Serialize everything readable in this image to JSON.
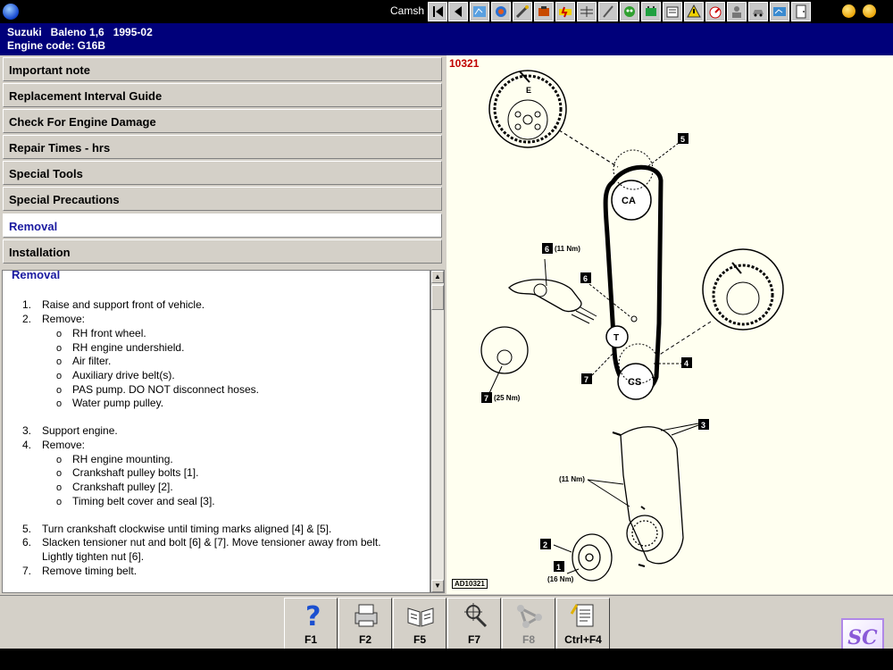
{
  "titlebar": {
    "title": "Camsh"
  },
  "header": {
    "vehicle": "Suzuki   Baleno 1,6   1995-02",
    "engine": "Engine code: G16B"
  },
  "menu": {
    "items": [
      {
        "label": "Important note"
      },
      {
        "label": "Replacement Interval Guide"
      },
      {
        "label": "Check For Engine Damage"
      },
      {
        "label": "Repair Times - hrs"
      },
      {
        "label": "Special Tools"
      },
      {
        "label": "Special Precautions"
      },
      {
        "label": "Removal"
      },
      {
        "label": "Installation"
      }
    ],
    "active": "Removal"
  },
  "content": {
    "heading": "Removal",
    "steps": [
      {
        "num": "1.",
        "text": "Raise and support front of vehicle."
      },
      {
        "num": "2.",
        "text": "Remove:"
      },
      {
        "num": "3.",
        "text": "Support engine."
      },
      {
        "num": "4.",
        "text": "Remove:"
      },
      {
        "num": "5.",
        "text": "Turn crankshaft clockwise until timing marks aligned [4] & [5]."
      },
      {
        "num": "6.",
        "text": "Slacken tensioner nut and bolt [6] & [7]. Move tensioner away from belt."
      },
      {
        "num": "",
        "text": "Lightly tighten nut [6]."
      },
      {
        "num": "7.",
        "text": "Remove timing belt."
      }
    ],
    "sub2": [
      "RH front wheel.",
      "RH engine undershield.",
      "Air filter.",
      "Auxiliary drive belt(s).",
      "PAS pump. DO NOT disconnect hoses.",
      "Water pump pulley."
    ],
    "sub4": [
      "RH engine mounting.",
      "Crankshaft pulley bolts [1].",
      "Crankshaft pulley [2].",
      "Timing belt cover and seal [3]."
    ],
    "bullet": "o"
  },
  "diagram": {
    "figure_id": "10321",
    "figure_ref": "AD10321",
    "labels": {
      "ca": "CA",
      "cs": "CS",
      "t": "T",
      "e": "E",
      "n1": "1",
      "n2": "2",
      "n3": "3",
      "n4": "4",
      "n5": "5",
      "n6": "6",
      "n7": "7",
      "torque6": "(11 Nm)",
      "torque7": "(25 Nm)",
      "torque_cover": "(11 Nm)",
      "torque1": "(16 Nm)"
    }
  },
  "function_keys": [
    {
      "label": "F1",
      "icon": "help-icon"
    },
    {
      "label": "F2",
      "icon": "printer-icon"
    },
    {
      "label": "F5",
      "icon": "book-icon"
    },
    {
      "label": "F7",
      "icon": "target-icon"
    },
    {
      "label": "F8",
      "icon": "belt-icon",
      "disabled": true
    },
    {
      "label": "Ctrl+F4",
      "icon": "document-icon"
    }
  ],
  "logo": {
    "text": "SC"
  },
  "colors": {
    "header_bg": "#00007a",
    "active_text": "#1a1aa0",
    "figure_id": "#c00000",
    "diagram_bg": "#fffff0"
  }
}
